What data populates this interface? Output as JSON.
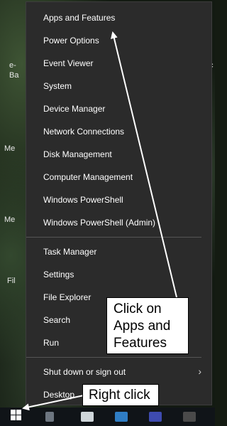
{
  "desktop_fragments": [
    "e-",
    "Ba",
    "Me",
    "Me",
    "Fil",
    "c"
  ],
  "menu": {
    "group1": [
      "Apps and Features",
      "Power Options",
      "Event Viewer",
      "System",
      "Device Manager",
      "Network Connections",
      "Disk Management",
      "Computer Management",
      "Windows PowerShell",
      "Windows PowerShell (Admin)"
    ],
    "group2": [
      "Task Manager",
      "Settings",
      "File Explorer",
      "Search",
      "Run"
    ],
    "group3": [
      "Shut down or sign out",
      "Desktop"
    ]
  },
  "callouts": {
    "click_apps": "Click on Apps and Features",
    "right_click": "Right click"
  },
  "icons": {
    "start": "windows-logo-icon",
    "submenu": "chevron-right-icon"
  },
  "colors": {
    "menu_bg": "#2b2b2b",
    "menu_text": "#ffffff",
    "separator": "#555555",
    "callout_bg": "#ffffff"
  }
}
